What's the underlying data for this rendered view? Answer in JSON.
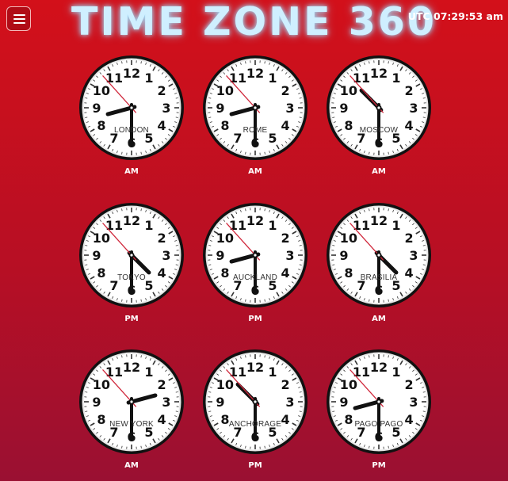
{
  "header": {
    "title": "TIME ZONE 360",
    "utc_label": "UTC 07:29:53 am"
  },
  "dial_numerals": [
    "12",
    "1",
    "2",
    "3",
    "4",
    "5",
    "6",
    "7",
    "8",
    "9",
    "10",
    "11"
  ],
  "clocks": [
    {
      "city": "LONDON",
      "period": "AM",
      "hour": 8,
      "minute": 30,
      "second": 53
    },
    {
      "city": "ROME",
      "period": "AM",
      "hour": 8,
      "minute": 30,
      "second": 53
    },
    {
      "city": "MOSCOW",
      "period": "AM",
      "hour": 10,
      "minute": 30,
      "second": 53
    },
    {
      "city": "TOKYO",
      "period": "PM",
      "hour": 4,
      "minute": 30,
      "second": 53
    },
    {
      "city": "AUCKLAND",
      "period": "PM",
      "hour": 8,
      "minute": 30,
      "second": 53
    },
    {
      "city": "BRASILIA",
      "period": "AM",
      "hour": 4,
      "minute": 30,
      "second": 53
    },
    {
      "city": "NEW YORK",
      "period": "AM",
      "hour": 2,
      "minute": 30,
      "second": 53
    },
    {
      "city": "ANCHORAGE",
      "period": "PM",
      "hour": 10,
      "minute": 30,
      "second": 53
    },
    {
      "city": "PAGO PAGO",
      "period": "PM",
      "hour": 8,
      "minute": 30,
      "second": 53
    }
  ],
  "colors": {
    "second_hand": "#d0283c",
    "hands": "#111111",
    "rim": "#111111"
  },
  "icons": {
    "menu": "hamburger-menu-icon"
  }
}
